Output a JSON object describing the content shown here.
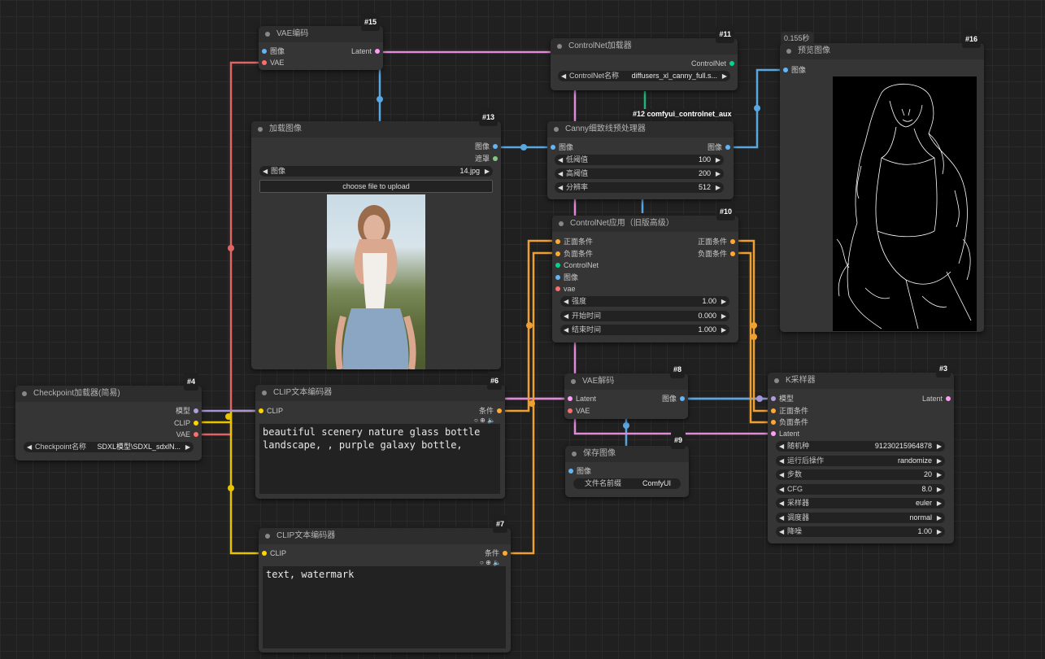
{
  "colors": {
    "clip": "#ffd500",
    "vae": "#ff6e6e",
    "image": "#64b5f6",
    "latent": "#ff9cf9",
    "model": "#b39ddb",
    "conditioning": "#ffa931",
    "controlnet": "#00d78d",
    "mask": "#81c784"
  },
  "n15": {
    "id": "#15",
    "title": "VAE编码",
    "in_image": "图像",
    "in_vae": "VAE",
    "out_latent": "Latent"
  },
  "n11": {
    "id": "#11",
    "title": "ControlNet加载器",
    "out": "ControlNet",
    "w_label": "ControlNet名称",
    "w_value": "diffusers_xl_canny_full.s..."
  },
  "n12": {
    "label": "#12 comfyui_controlnet_aux"
  },
  "n16": {
    "id": "#16",
    "title": "预览图像",
    "in_image": "图像",
    "timer": "0.155秒"
  },
  "n13": {
    "id": "#13",
    "title": "加载图像",
    "out_image": "图像",
    "out_mask": "遮罩",
    "w_label": "图像",
    "w_value": "14.jpg",
    "upload": "choose file to upload"
  },
  "nCanny": {
    "title": "Canny细致线预处理器",
    "in_image": "图像",
    "out_image": "图像",
    "widgets": [
      {
        "label": "低阈值",
        "value": "100"
      },
      {
        "label": "高阈值",
        "value": "200"
      },
      {
        "label": "分辨率",
        "value": "512"
      }
    ]
  },
  "n10": {
    "id": "#10",
    "title": "ControlNet应用（旧版高级）",
    "inputs": [
      "正面条件",
      "负面条件",
      "ControlNet",
      "图像",
      "vae"
    ],
    "outputs": [
      "正面条件",
      "负面条件"
    ],
    "widgets": [
      {
        "label": "强度",
        "value": "1.00"
      },
      {
        "label": "开始时间",
        "value": "0.000"
      },
      {
        "label": "结束时间",
        "value": "1.000"
      }
    ]
  },
  "n4": {
    "id": "#4",
    "title": "Checkpoint加载器(简易)",
    "outputs": [
      "模型",
      "CLIP",
      "VAE"
    ],
    "w_label": "Checkpoint名称",
    "w_value": "SDXL模型\\SDXL_sdxlN..."
  },
  "n6": {
    "id": "#6",
    "title": "CLIP文本编码器",
    "in": "CLIP",
    "out": "条件",
    "text": "beautiful scenery nature glass bottle\nlandscape, , purple galaxy bottle,"
  },
  "n8": {
    "id": "#8",
    "title": "VAE解码",
    "in_latent": "Latent",
    "in_vae": "VAE",
    "out": "图像"
  },
  "n9": {
    "id": "#9",
    "title": "保存图像",
    "in": "图像",
    "w_label": "文件名前缀",
    "w_value": "ComfyUI"
  },
  "n3": {
    "id": "#3",
    "title": "K采样器",
    "inputs": [
      "模型",
      "正面条件",
      "负面条件",
      "Latent"
    ],
    "out": "Latent",
    "widgets": [
      {
        "label": "随机种",
        "value": "91230215964878"
      },
      {
        "label": "运行后操作",
        "value": "randomize"
      },
      {
        "label": "步数",
        "value": "20"
      },
      {
        "label": "CFG",
        "value": "8.0"
      },
      {
        "label": "采样器",
        "value": "euler"
      },
      {
        "label": "调度器",
        "value": "normal"
      },
      {
        "label": "降噪",
        "value": "1.00"
      }
    ]
  },
  "n7": {
    "id": "#7",
    "title": "CLIP文本编码器",
    "in": "CLIP",
    "out": "条件",
    "text": "text, watermark"
  },
  "icons": {
    "text_widget_icons": "○ ⊕ 🔈"
  }
}
